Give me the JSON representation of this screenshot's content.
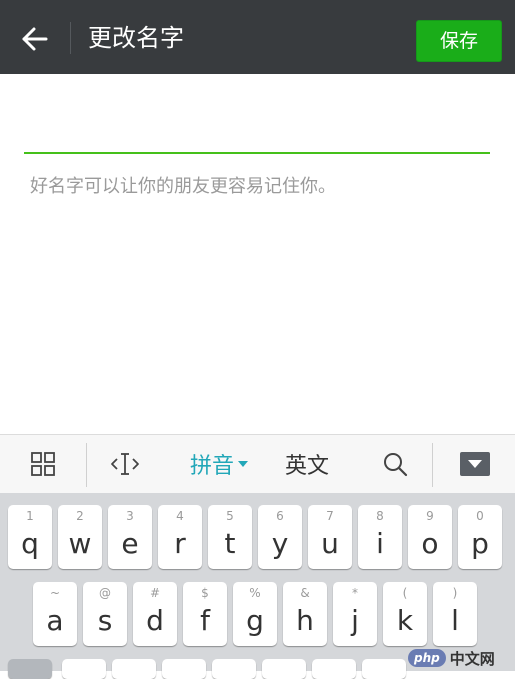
{
  "header": {
    "back_icon": "arrow-left-icon",
    "title": "更改名字",
    "save_label": "保存",
    "bg_color": "#383b3e",
    "save_color": "#1aad19"
  },
  "form": {
    "name_value": "",
    "underline_color": "#45c01a",
    "hint": "好名字可以让你的朋友更容易记住你。"
  },
  "ime_toolbar": {
    "grid_icon": "grid-menu-icon",
    "cursor_icon": "cursor-move-icon",
    "pinyin_label": "拼音",
    "english_label": "英文",
    "search_icon": "search-icon",
    "hide_icon": "keyboard-hide-icon",
    "active_color": "#22a7b8"
  },
  "keyboard": {
    "row1": [
      {
        "main": "q",
        "alt": "1"
      },
      {
        "main": "w",
        "alt": "2"
      },
      {
        "main": "e",
        "alt": "3"
      },
      {
        "main": "r",
        "alt": "4"
      },
      {
        "main": "t",
        "alt": "5"
      },
      {
        "main": "y",
        "alt": "6"
      },
      {
        "main": "u",
        "alt": "7"
      },
      {
        "main": "i",
        "alt": "8"
      },
      {
        "main": "o",
        "alt": "9"
      },
      {
        "main": "p",
        "alt": "0"
      }
    ],
    "row2": [
      {
        "main": "a",
        "alt": "~"
      },
      {
        "main": "s",
        "alt": "@"
      },
      {
        "main": "d",
        "alt": "#"
      },
      {
        "main": "f",
        "alt": "$"
      },
      {
        "main": "g",
        "alt": "%"
      },
      {
        "main": "h",
        "alt": "&"
      },
      {
        "main": "j",
        "alt": "*"
      },
      {
        "main": "k",
        "alt": "("
      },
      {
        "main": "l",
        "alt": ")"
      }
    ]
  },
  "watermark": {
    "logo": "php",
    "text": "中文网"
  }
}
